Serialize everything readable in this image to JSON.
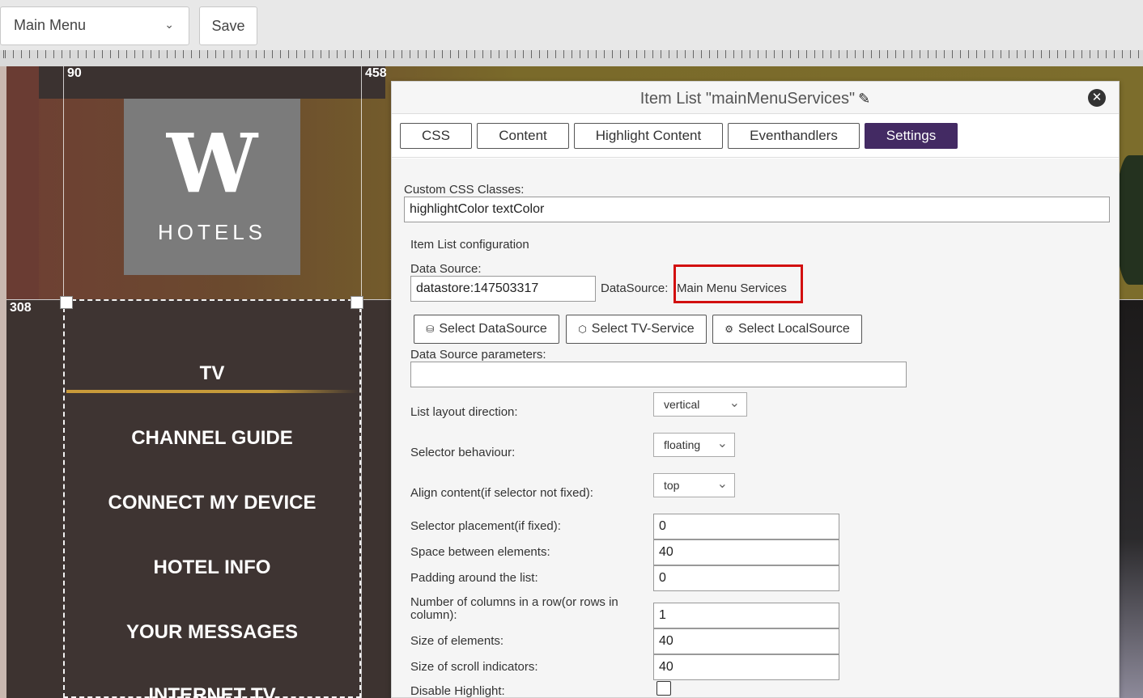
{
  "toolbar": {
    "page_select": "Main Menu",
    "save_label": "Save"
  },
  "canvas": {
    "coord_left": "90",
    "coord_right": "458",
    "coord_top": "308",
    "logo": {
      "letter": "W",
      "word": "HOTELS"
    },
    "menu_items": [
      "TV",
      "CHANNEL GUIDE",
      "CONNECT MY DEVICE",
      "HOTEL INFO",
      "YOUR MESSAGES",
      "INTERNET TV"
    ]
  },
  "dialog": {
    "title": "Item List \"mainMenuServices\"",
    "tabs": [
      "CSS",
      "Content",
      "Highlight Content",
      "Eventhandlers",
      "Settings"
    ],
    "active_tab": "Settings",
    "custom_css_label": "Custom CSS Classes:",
    "custom_css_value": "highlightColor textColor",
    "item_list_config": "Item List configuration",
    "data_source_label": "Data Source:",
    "data_source_value": "datastore:147503317",
    "datasource_caption": "DataSource:",
    "datasource_name": "Main Menu Services",
    "btn_select_datasource": "Select DataSource",
    "btn_select_tv_service": "Select TV-Service",
    "btn_select_localsource": "Select LocalSource",
    "ds_params_label": "Data Source parameters:",
    "ds_params_value": "",
    "layout_direction_label": "List layout direction:",
    "layout_direction_value": "vertical",
    "selector_behaviour_label": "Selector behaviour:",
    "selector_behaviour_value": "floating",
    "align_content_label": "Align content(if selector not fixed):",
    "align_content_value": "top",
    "selector_placement_label": "Selector placement(if fixed):",
    "selector_placement_value": "0",
    "space_between_label": "Space between elements:",
    "space_between_value": "40",
    "padding_label": "Padding around the list:",
    "padding_value": "0",
    "columns_label": "Number of columns in a row(or rows in column):",
    "columns_value": "1",
    "size_elements_label": "Size of elements:",
    "size_elements_value": "40",
    "size_scroll_label": "Size of scroll indicators:",
    "size_scroll_value": "40",
    "disable_highlight_label": "Disable Highlight:"
  }
}
